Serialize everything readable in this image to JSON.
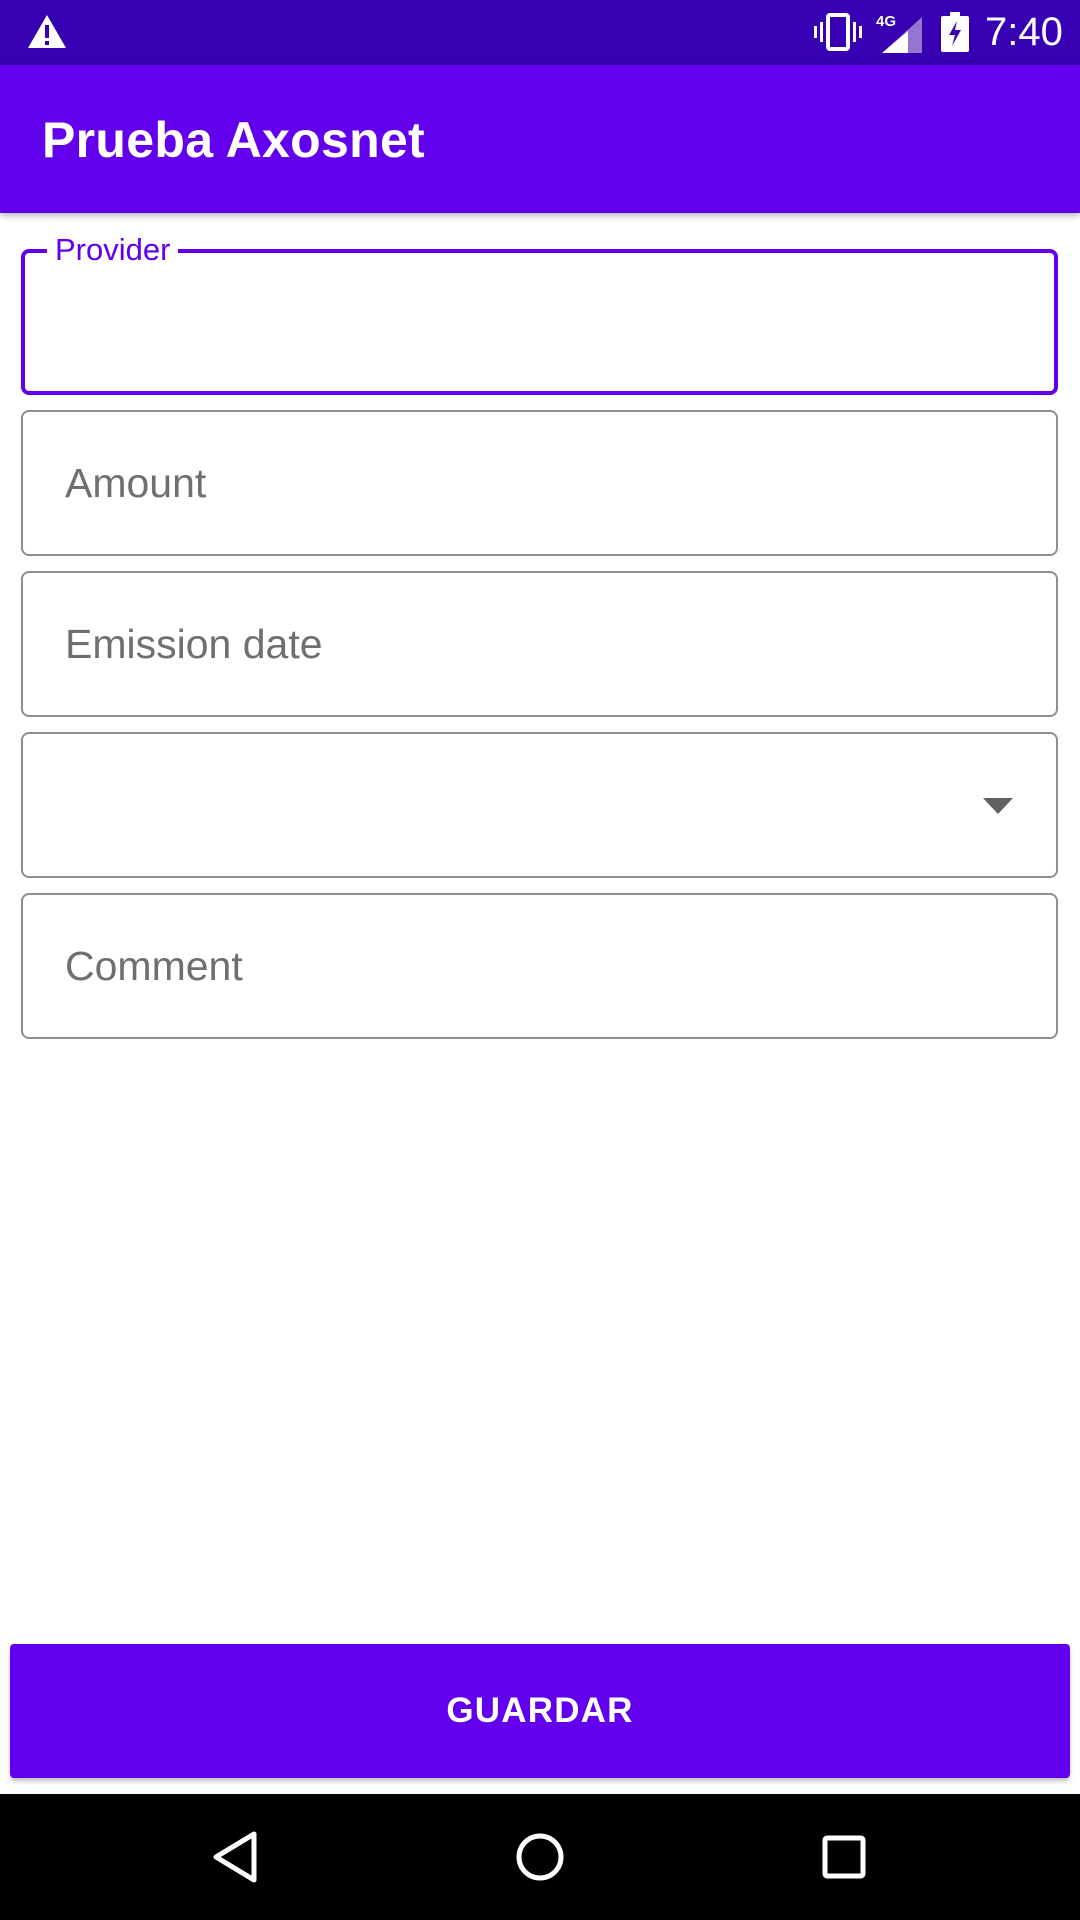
{
  "status_bar": {
    "time": "7:40",
    "network": "4G",
    "icons": [
      "warning-icon",
      "vibrate-icon",
      "signal-icon",
      "battery-charging-icon"
    ]
  },
  "app_bar": {
    "title": "Prueba Axosnet"
  },
  "form": {
    "provider": {
      "label": "Provider",
      "value": ""
    },
    "amount": {
      "placeholder": "Amount",
      "value": ""
    },
    "emission_date": {
      "placeholder": "Emission date",
      "value": ""
    },
    "currency_select": {
      "selected": ""
    },
    "comment": {
      "placeholder": "Comment",
      "value": ""
    }
  },
  "save_button": {
    "label": "GUARDAR"
  },
  "colors": {
    "primary": "#6200EE",
    "primary_dark": "#3700B3",
    "outline": "#8e8e8e",
    "hint": "#6f6f6f"
  },
  "nav_bar": {
    "icons": [
      "back-icon",
      "home-icon",
      "recents-icon"
    ]
  }
}
